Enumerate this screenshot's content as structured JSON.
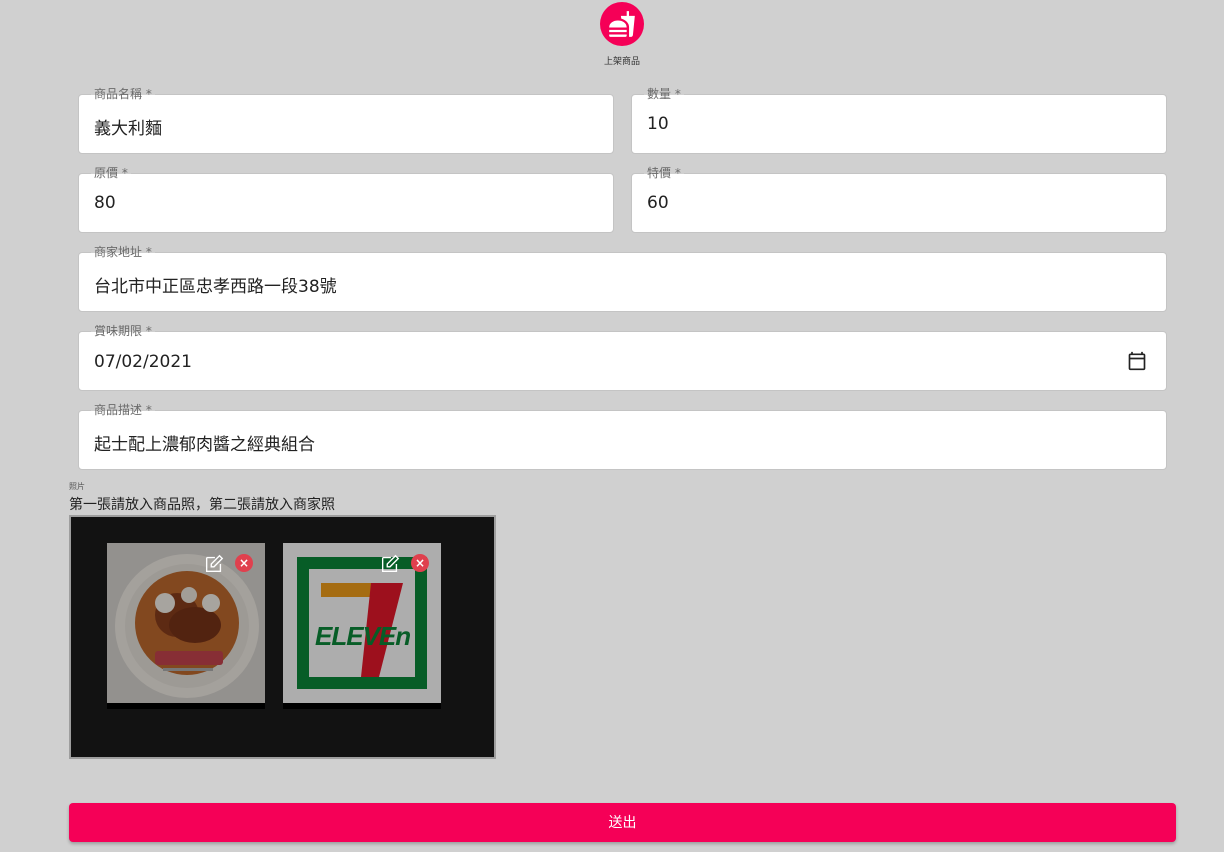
{
  "header": {
    "caption": "上架商品",
    "logo_icon": "fastfood-icon",
    "accent": "#f50057"
  },
  "form": {
    "name": {
      "label": "商品名稱 *",
      "value": "義大利麵"
    },
    "quantity": {
      "label": "數量 *",
      "value": "10"
    },
    "original_price": {
      "label": "原價 *",
      "value": "80"
    },
    "special_price": {
      "label": "特價 *",
      "value": "60"
    },
    "address": {
      "label": "商家地址 *",
      "value": "台北市中正區忠孝西路一段38號"
    },
    "expiry": {
      "label": "賞味期限 *",
      "value": "07/02/2021"
    },
    "description": {
      "label": "商品描述 *",
      "value": "起士配上濃郁肉醬之經典組合"
    }
  },
  "photos": {
    "label": "照片",
    "hint": "第一張請放入商品照，第二張請放入商家照",
    "images": [
      {
        "name": "product-photo",
        "edit_icon": "edit-icon",
        "remove_icon": "close-icon",
        "remove_glyph": "×"
      },
      {
        "name": "store-photo",
        "logo_text": "ELEVEn",
        "edit_icon": "edit-icon",
        "remove_icon": "close-icon",
        "remove_glyph": "×"
      }
    ]
  },
  "submit": {
    "label": "送出"
  }
}
